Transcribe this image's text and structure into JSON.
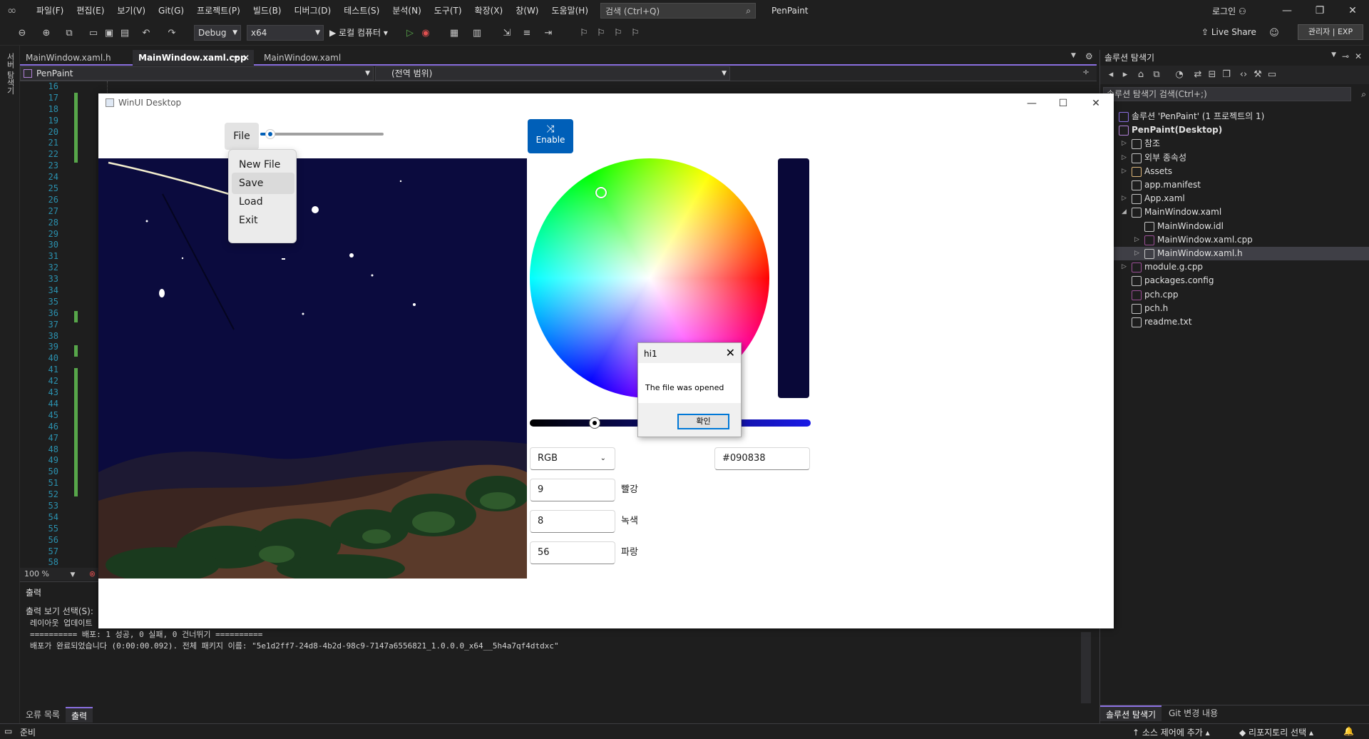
{
  "titlebar": {
    "menu": [
      "파일(F)",
      "편집(E)",
      "보기(V)",
      "Git(G)",
      "프로젝트(P)",
      "빌드(B)",
      "디버그(D)",
      "테스트(S)",
      "분석(N)",
      "도구(T)",
      "확장(X)",
      "창(W)",
      "도움말(H)"
    ],
    "search_placeholder": "검색 (Ctrl+Q)",
    "app_title": "PenPaint",
    "login": "로그인"
  },
  "toolbar": {
    "config": "Debug",
    "platform": "x64",
    "run_label": "▶ 로컬 컴퓨터 ▾",
    "live_share": "Live Share",
    "admin": "관리자 | EXP"
  },
  "left_strip_label": "서버 탐색기",
  "doc_tabs": [
    "MainWindow.xaml.h",
    "MainWindow.xaml.cpp",
    "MainWindow.xaml"
  ],
  "nav": {
    "project": "PenPaint",
    "scope": "(전역 범위)"
  },
  "editor": {
    "line_numbers": [
      "16",
      "17",
      "18",
      "19",
      "20",
      "21",
      "22",
      "23",
      "24",
      "25",
      "26",
      "27",
      "28",
      "29",
      "30",
      "31",
      "32",
      "33",
      "34",
      "35",
      "36",
      "37",
      "38",
      "39",
      "40",
      "41",
      "42",
      "43",
      "44",
      "45",
      "46",
      "47",
      "48",
      "49",
      "50",
      "51",
      "52",
      "53",
      "54",
      "55",
      "56",
      "57",
      "58"
    ],
    "zoom": "100 %"
  },
  "output": {
    "header": "출력",
    "select_label": "출력 보기 선택(S):",
    "lines": [
      "레이아웃 업데이트",
      "========== 배포: 1 성공, 0 실패, 0 건너뛰기 ==========",
      "배포가 완료되었습니다 (0:00:00.092). 전체 패키지 이름: \"5e1d2ff7-24d8-4b2d-98c9-7147a6556821_1.0.0.0_x64__5h4a7qf4dtdxc\""
    ],
    "tabs": [
      "오류 목록",
      "출력"
    ]
  },
  "solution": {
    "header": "솔루션 탐색기",
    "search": "솔루션 탐색기 검색(Ctrl+;)",
    "items": [
      {
        "label": "솔루션 'PenPaint' (1 프로젝트의 1)",
        "indent": 0,
        "exp": "",
        "color": "#8a6fe0"
      },
      {
        "label": "PenPaint(Desktop)",
        "indent": 0,
        "exp": "",
        "color": "#b180d7",
        "bold": true
      },
      {
        "label": "참조",
        "indent": 1,
        "exp": "▷",
        "color": "#c5c5c5"
      },
      {
        "label": "외부 종속성",
        "indent": 1,
        "exp": "▷",
        "color": "#c5c5c5"
      },
      {
        "label": "Assets",
        "indent": 1,
        "exp": "▷",
        "color": "#dcb67a"
      },
      {
        "label": "app.manifest",
        "indent": 1,
        "exp": "",
        "color": "#c5c5c5"
      },
      {
        "label": "App.xaml",
        "indent": 1,
        "exp": "▷",
        "color": "#c5c5c5"
      },
      {
        "label": "MainWindow.xaml",
        "indent": 1,
        "exp": "◢",
        "color": "#c5c5c5"
      },
      {
        "label": "MainWindow.idl",
        "indent": 2,
        "exp": "",
        "color": "#c5c5c5"
      },
      {
        "label": "MainWindow.xaml.cpp",
        "indent": 2,
        "exp": "▷",
        "color": "#9b4f96"
      },
      {
        "label": "MainWindow.xaml.h",
        "indent": 2,
        "exp": "▷",
        "color": "#c5c5c5",
        "selected": true
      },
      {
        "label": "module.g.cpp",
        "indent": 1,
        "exp": "▷",
        "color": "#9b4f96"
      },
      {
        "label": "packages.config",
        "indent": 1,
        "exp": "",
        "color": "#c5c5c5"
      },
      {
        "label": "pch.cpp",
        "indent": 1,
        "exp": "",
        "color": "#9b4f96"
      },
      {
        "label": "pch.h",
        "indent": 1,
        "exp": "",
        "color": "#c5c5c5"
      },
      {
        "label": "readme.txt",
        "indent": 1,
        "exp": "",
        "color": "#c5c5c5"
      }
    ],
    "bottom_tabs": [
      "솔루션 탐색기",
      "Git 변경 내용"
    ]
  },
  "statusbar": {
    "ready": "준비",
    "source_control": "↑ 소스 제어에 추가 ▴",
    "repo": "◆ 리포지토리 선택 ▴"
  },
  "app": {
    "window_title": "WinUI Desktop",
    "file_button": "File",
    "file_menu": [
      "New File",
      "Save",
      "Load",
      "Exit"
    ],
    "brush_size_fraction": 0.08,
    "enable_label": "Enable",
    "color_mode": "RGB",
    "hex": "#090838",
    "red": "9",
    "green": "8",
    "blue": "56",
    "red_label": "빨강",
    "green_label": "녹색",
    "blue_label": "파랑",
    "colors": {
      "selected": "#090838",
      "accent": "#005fb8"
    }
  },
  "dialog": {
    "title": "hi1",
    "message": "The file was opened",
    "ok": "확인"
  }
}
